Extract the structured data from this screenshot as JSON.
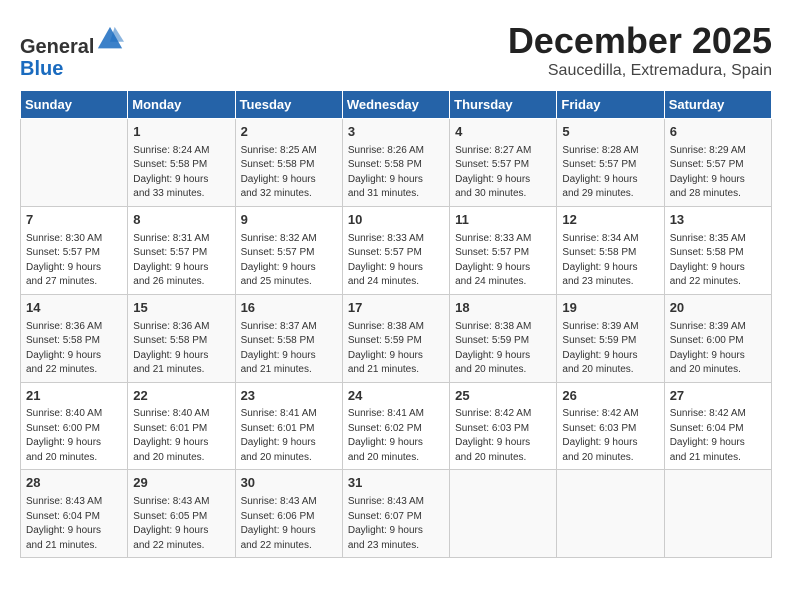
{
  "header": {
    "logo_general": "General",
    "logo_blue": "Blue",
    "title": "December 2025",
    "subtitle": "Saucedilla, Extremadura, Spain"
  },
  "weekdays": [
    "Sunday",
    "Monday",
    "Tuesday",
    "Wednesday",
    "Thursday",
    "Friday",
    "Saturday"
  ],
  "weeks": [
    [
      {
        "day": "",
        "info": ""
      },
      {
        "day": "1",
        "info": "Sunrise: 8:24 AM\nSunset: 5:58 PM\nDaylight: 9 hours\nand 33 minutes."
      },
      {
        "day": "2",
        "info": "Sunrise: 8:25 AM\nSunset: 5:58 PM\nDaylight: 9 hours\nand 32 minutes."
      },
      {
        "day": "3",
        "info": "Sunrise: 8:26 AM\nSunset: 5:58 PM\nDaylight: 9 hours\nand 31 minutes."
      },
      {
        "day": "4",
        "info": "Sunrise: 8:27 AM\nSunset: 5:57 PM\nDaylight: 9 hours\nand 30 minutes."
      },
      {
        "day": "5",
        "info": "Sunrise: 8:28 AM\nSunset: 5:57 PM\nDaylight: 9 hours\nand 29 minutes."
      },
      {
        "day": "6",
        "info": "Sunrise: 8:29 AM\nSunset: 5:57 PM\nDaylight: 9 hours\nand 28 minutes."
      }
    ],
    [
      {
        "day": "7",
        "info": "Sunrise: 8:30 AM\nSunset: 5:57 PM\nDaylight: 9 hours\nand 27 minutes."
      },
      {
        "day": "8",
        "info": "Sunrise: 8:31 AM\nSunset: 5:57 PM\nDaylight: 9 hours\nand 26 minutes."
      },
      {
        "day": "9",
        "info": "Sunrise: 8:32 AM\nSunset: 5:57 PM\nDaylight: 9 hours\nand 25 minutes."
      },
      {
        "day": "10",
        "info": "Sunrise: 8:33 AM\nSunset: 5:57 PM\nDaylight: 9 hours\nand 24 minutes."
      },
      {
        "day": "11",
        "info": "Sunrise: 8:33 AM\nSunset: 5:57 PM\nDaylight: 9 hours\nand 24 minutes."
      },
      {
        "day": "12",
        "info": "Sunrise: 8:34 AM\nSunset: 5:58 PM\nDaylight: 9 hours\nand 23 minutes."
      },
      {
        "day": "13",
        "info": "Sunrise: 8:35 AM\nSunset: 5:58 PM\nDaylight: 9 hours\nand 22 minutes."
      }
    ],
    [
      {
        "day": "14",
        "info": "Sunrise: 8:36 AM\nSunset: 5:58 PM\nDaylight: 9 hours\nand 22 minutes."
      },
      {
        "day": "15",
        "info": "Sunrise: 8:36 AM\nSunset: 5:58 PM\nDaylight: 9 hours\nand 21 minutes."
      },
      {
        "day": "16",
        "info": "Sunrise: 8:37 AM\nSunset: 5:58 PM\nDaylight: 9 hours\nand 21 minutes."
      },
      {
        "day": "17",
        "info": "Sunrise: 8:38 AM\nSunset: 5:59 PM\nDaylight: 9 hours\nand 21 minutes."
      },
      {
        "day": "18",
        "info": "Sunrise: 8:38 AM\nSunset: 5:59 PM\nDaylight: 9 hours\nand 20 minutes."
      },
      {
        "day": "19",
        "info": "Sunrise: 8:39 AM\nSunset: 5:59 PM\nDaylight: 9 hours\nand 20 minutes."
      },
      {
        "day": "20",
        "info": "Sunrise: 8:39 AM\nSunset: 6:00 PM\nDaylight: 9 hours\nand 20 minutes."
      }
    ],
    [
      {
        "day": "21",
        "info": "Sunrise: 8:40 AM\nSunset: 6:00 PM\nDaylight: 9 hours\nand 20 minutes."
      },
      {
        "day": "22",
        "info": "Sunrise: 8:40 AM\nSunset: 6:01 PM\nDaylight: 9 hours\nand 20 minutes."
      },
      {
        "day": "23",
        "info": "Sunrise: 8:41 AM\nSunset: 6:01 PM\nDaylight: 9 hours\nand 20 minutes."
      },
      {
        "day": "24",
        "info": "Sunrise: 8:41 AM\nSunset: 6:02 PM\nDaylight: 9 hours\nand 20 minutes."
      },
      {
        "day": "25",
        "info": "Sunrise: 8:42 AM\nSunset: 6:03 PM\nDaylight: 9 hours\nand 20 minutes."
      },
      {
        "day": "26",
        "info": "Sunrise: 8:42 AM\nSunset: 6:03 PM\nDaylight: 9 hours\nand 20 minutes."
      },
      {
        "day": "27",
        "info": "Sunrise: 8:42 AM\nSunset: 6:04 PM\nDaylight: 9 hours\nand 21 minutes."
      }
    ],
    [
      {
        "day": "28",
        "info": "Sunrise: 8:43 AM\nSunset: 6:04 PM\nDaylight: 9 hours\nand 21 minutes."
      },
      {
        "day": "29",
        "info": "Sunrise: 8:43 AM\nSunset: 6:05 PM\nDaylight: 9 hours\nand 22 minutes."
      },
      {
        "day": "30",
        "info": "Sunrise: 8:43 AM\nSunset: 6:06 PM\nDaylight: 9 hours\nand 22 minutes."
      },
      {
        "day": "31",
        "info": "Sunrise: 8:43 AM\nSunset: 6:07 PM\nDaylight: 9 hours\nand 23 minutes."
      },
      {
        "day": "",
        "info": ""
      },
      {
        "day": "",
        "info": ""
      },
      {
        "day": "",
        "info": ""
      }
    ]
  ]
}
